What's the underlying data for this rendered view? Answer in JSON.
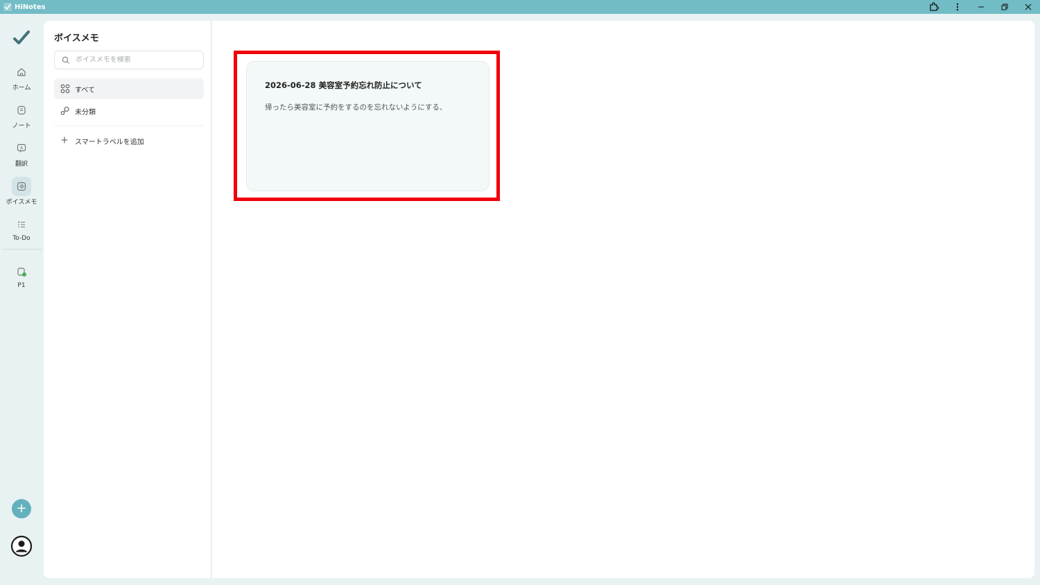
{
  "window": {
    "app_title": "HiNotes"
  },
  "rail": {
    "items": [
      {
        "label": "ホーム",
        "icon": "home-icon"
      },
      {
        "label": "ノート",
        "icon": "note-icon"
      },
      {
        "label": "翻訳",
        "icon": "translate-icon"
      },
      {
        "label": "ボイスメモ",
        "icon": "voice-memo-icon",
        "active": true
      },
      {
        "label": "To-Do",
        "icon": "todo-list-icon"
      }
    ],
    "device_label": "P1",
    "add_label": "+"
  },
  "panel": {
    "title": "ボイスメモ",
    "search_placeholder": "ボイスメモを検索",
    "categories": [
      {
        "label": "すべて",
        "icon": "grid-icon",
        "active": true
      },
      {
        "label": "未分類",
        "icon": "unclassified-icon"
      }
    ],
    "add_smart_label": "スマートラベルを追加"
  },
  "memos": [
    {
      "title": "2026-06-28 美容室予約忘れ防止について",
      "body": "帰ったら美容室に予約をするのを忘れないようにする、"
    }
  ],
  "colors": {
    "titlebar": "#72bcc6",
    "accent": "#63b1bd",
    "highlight": "#f0000a",
    "status_dot": "#4caf50"
  }
}
